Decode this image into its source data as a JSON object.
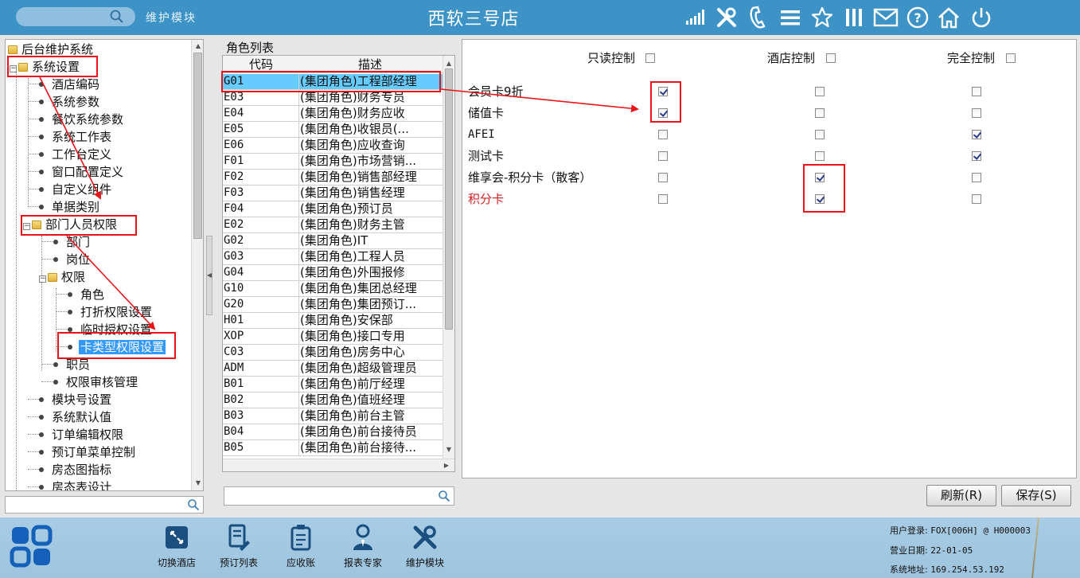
{
  "topbar": {
    "module_label": "维护模块",
    "store_title": "西软三号店",
    "icons": [
      "signal-icon",
      "tools-icon",
      "phone-icon",
      "menu-icon",
      "star-icon",
      "columns-icon",
      "mail-icon",
      "help-icon",
      "home-icon",
      "power-icon"
    ]
  },
  "tree": {
    "nodes": [
      {
        "label": "后台维护系统",
        "type": "folder"
      },
      {
        "label": "系统设置",
        "type": "folder"
      },
      {
        "label": "酒店编码",
        "type": "leaf"
      },
      {
        "label": "系统参数",
        "type": "leaf"
      },
      {
        "label": "餐饮系统参数",
        "type": "leaf"
      },
      {
        "label": "系统工作表",
        "type": "leaf"
      },
      {
        "label": "工作台定义",
        "type": "leaf"
      },
      {
        "label": "窗口配置定义",
        "type": "leaf"
      },
      {
        "label": "自定义组件",
        "type": "leaf"
      },
      {
        "label": "单据类别",
        "type": "leaf"
      },
      {
        "label": "部门人员权限",
        "type": "folder"
      },
      {
        "label": "部门",
        "type": "leaf"
      },
      {
        "label": "岗位",
        "type": "leaf"
      },
      {
        "label": "权限",
        "type": "folder"
      },
      {
        "label": "角色",
        "type": "leaf"
      },
      {
        "label": "打折权限设置",
        "type": "leaf"
      },
      {
        "label": "临时授权设置",
        "type": "leaf"
      },
      {
        "label": "卡类型权限设置",
        "type": "leaf",
        "selected": true
      },
      {
        "label": "职员",
        "type": "leaf"
      },
      {
        "label": "权限审核管理",
        "type": "leaf"
      },
      {
        "label": "模块号设置",
        "type": "leaf"
      },
      {
        "label": "系统默认值",
        "type": "leaf"
      },
      {
        "label": "订单编辑权限",
        "type": "leaf"
      },
      {
        "label": "预订单菜单控制",
        "type": "leaf"
      },
      {
        "label": "房态图指标",
        "type": "leaf"
      },
      {
        "label": "房态表设计",
        "type": "leaf"
      }
    ]
  },
  "roles": {
    "title": "角色列表",
    "col_code": "代码",
    "col_desc": "描述",
    "rows": [
      {
        "code": "G01",
        "desc": "(集团角色)工程部经理",
        "selected": true
      },
      {
        "code": "E03",
        "desc": "(集团角色)财务专员"
      },
      {
        "code": "E04",
        "desc": "(集团角色)财务应收"
      },
      {
        "code": "E05",
        "desc": "(集团角色)收银员(..."
      },
      {
        "code": "E06",
        "desc": "(集团角色)应收查询"
      },
      {
        "code": "F01",
        "desc": "(集团角色)市场营销..."
      },
      {
        "code": "F02",
        "desc": "(集团角色)销售部经理"
      },
      {
        "code": "F03",
        "desc": "(集团角色)销售经理"
      },
      {
        "code": "F04",
        "desc": "(集团角色)预订员"
      },
      {
        "code": "E02",
        "desc": "(集团角色)财务主管"
      },
      {
        "code": "G02",
        "desc": "(集团角色)IT"
      },
      {
        "code": "G03",
        "desc": "(集团角色)工程人员"
      },
      {
        "code": "G04",
        "desc": "(集团角色)外围报修"
      },
      {
        "code": "G10",
        "desc": "(集团角色)集团总经理"
      },
      {
        "code": "G20",
        "desc": "(集团角色)集团预订..."
      },
      {
        "code": "H01",
        "desc": "(集团角色)安保部"
      },
      {
        "code": "XOP",
        "desc": "(集团角色)接口专用"
      },
      {
        "code": "C03",
        "desc": "(集团角色)房务中心"
      },
      {
        "code": "ADM",
        "desc": "(集团角色)超级管理员"
      },
      {
        "code": "B01",
        "desc": "(集团角色)前厅经理"
      },
      {
        "code": "B02",
        "desc": "(集团角色)值班经理"
      },
      {
        "code": "B03",
        "desc": "(集团角色)前台主管"
      },
      {
        "code": "B04",
        "desc": "(集团角色)前台接待员"
      },
      {
        "code": "B05",
        "desc": "(集团角色)前台接待..."
      }
    ]
  },
  "permissions": {
    "headers": {
      "readonly": "只读控制",
      "hotel": "酒店控制",
      "full": "完全控制"
    },
    "header_checks": {
      "readonly": false,
      "hotel": false,
      "full": false
    },
    "rows": [
      {
        "name": "会员卡9折",
        "readonly": true,
        "hotel": false,
        "full": false
      },
      {
        "name": "储值卡",
        "readonly": true,
        "hotel": false,
        "full": false
      },
      {
        "name": "AFEI",
        "readonly": false,
        "hotel": false,
        "full": true
      },
      {
        "name": "测试卡",
        "readonly": false,
        "hotel": false,
        "full": true
      },
      {
        "name": "维享会-积分卡（散客）",
        "readonly": false,
        "hotel": true,
        "full": false
      },
      {
        "name": "积分卡",
        "readonly": false,
        "hotel": true,
        "full": false,
        "color": "#d42020"
      }
    ]
  },
  "buttons": {
    "refresh": "刷新(R)",
    "save": "保存(S)"
  },
  "taskbar": {
    "items": [
      {
        "label": "切换酒店",
        "icon": "switch-hotel-icon"
      },
      {
        "label": "预订列表",
        "icon": "reservation-list-icon"
      },
      {
        "label": "应收账",
        "icon": "receivable-icon"
      },
      {
        "label": "报表专家",
        "icon": "report-expert-icon"
      },
      {
        "label": "维护模块",
        "icon": "maintenance-icon"
      }
    ],
    "status": {
      "login_label": "用户登录:",
      "login_value": "FOX[006H] @ H000003",
      "date_label": "营业日期:",
      "date_value": "22-01-05",
      "addr_label": "系统地址:",
      "addr_value": "169.254.53.192"
    }
  },
  "colors": {
    "topbar": "#3d92c6",
    "taskbar": "#a8cce4",
    "annotation": "#e8141a",
    "selected_row": "#66ccff",
    "selected_tree": "#3399ff"
  }
}
